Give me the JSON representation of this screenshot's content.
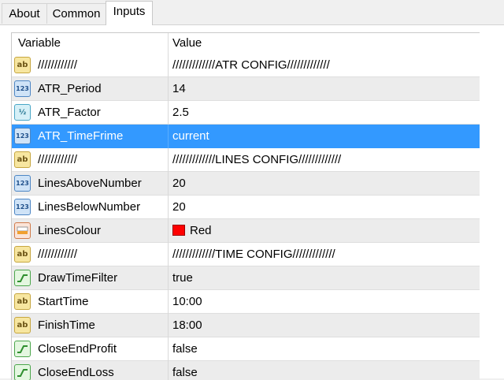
{
  "tabs": [
    {
      "label": "About"
    },
    {
      "label": "Common"
    },
    {
      "label": "Inputs"
    }
  ],
  "table": {
    "headers": {
      "variable": "Variable",
      "value": "Value"
    },
    "rows": [
      {
        "icon": "ab",
        "variable": "////////////",
        "value": "/////////////ATR CONFIG/////////////"
      },
      {
        "icon": "123",
        "variable": "ATR_Period",
        "value": "14"
      },
      {
        "icon": "frac",
        "variable": "ATR_Factor",
        "value": "2.5"
      },
      {
        "icon": "123",
        "variable": "ATR_TimeFrime",
        "value": "current"
      },
      {
        "icon": "ab",
        "variable": "////////////",
        "value": "/////////////LINES CONFIG/////////////"
      },
      {
        "icon": "123",
        "variable": "LinesAboveNumber",
        "value": "20"
      },
      {
        "icon": "123",
        "variable": "LinesBelowNumber",
        "value": "20"
      },
      {
        "icon": "color",
        "variable": "LinesColour",
        "value": "Red",
        "swatch": "#ff0000"
      },
      {
        "icon": "ab",
        "variable": "////////////",
        "value": "/////////////TIME CONFIG/////////////"
      },
      {
        "icon": "bool",
        "variable": "DrawTimeFilter",
        "value": "true"
      },
      {
        "icon": "ab",
        "variable": "StartTime",
        "value": "10:00"
      },
      {
        "icon": "ab",
        "variable": "FinishTime",
        "value": "18:00"
      },
      {
        "icon": "bool",
        "variable": "CloseEndProfit",
        "value": "false"
      },
      {
        "icon": "bool",
        "variable": "CloseEndLoss",
        "value": "false"
      }
    ]
  },
  "selected_variable": "ATR_TimeFrime",
  "colors": {
    "selection": "#3399ff",
    "swatch_red": "#ff0000"
  }
}
